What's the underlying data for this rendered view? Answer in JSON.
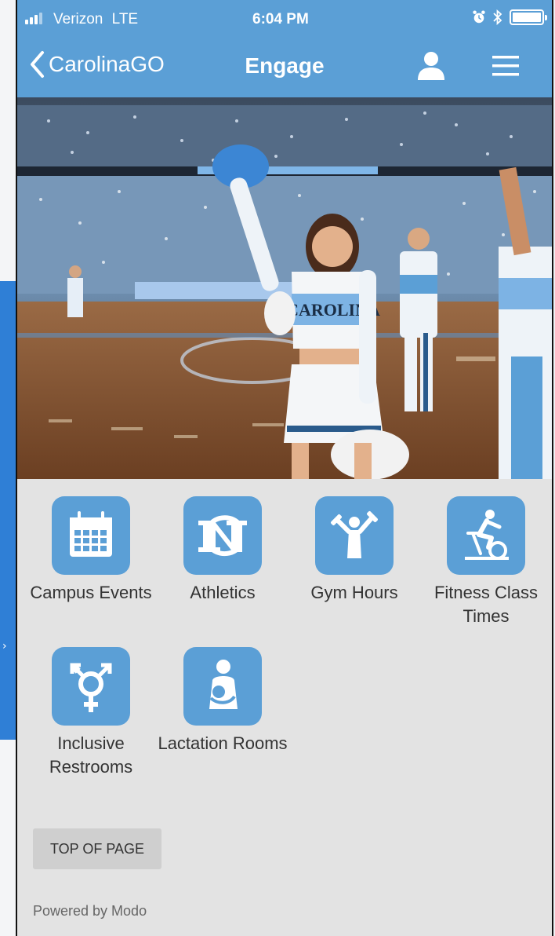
{
  "status_bar": {
    "carrier": "Verizon",
    "network": "LTE",
    "time": "6:04 PM"
  },
  "nav": {
    "back_label": "CarolinaGO",
    "title": "Engage"
  },
  "hero": {
    "jersey_text": "CAROLINA"
  },
  "tiles": [
    {
      "label": "Campus Events",
      "icon": "calendar-icon"
    },
    {
      "label": "Athletics",
      "icon": "nc-logo-icon"
    },
    {
      "label": "Gym Hours",
      "icon": "weightlifter-icon"
    },
    {
      "label": "Fitness Class Times",
      "icon": "exercise-bike-icon"
    },
    {
      "label": "Inclusive Restrooms",
      "icon": "gender-inclusive-icon"
    },
    {
      "label": "Lactation Rooms",
      "icon": "nursing-mother-icon"
    }
  ],
  "footer": {
    "top_button": "TOP OF PAGE",
    "powered_by": "Powered by Modo"
  },
  "colors": {
    "brand_blue": "#5b9fd6",
    "page_bg": "#e3e3e3"
  }
}
